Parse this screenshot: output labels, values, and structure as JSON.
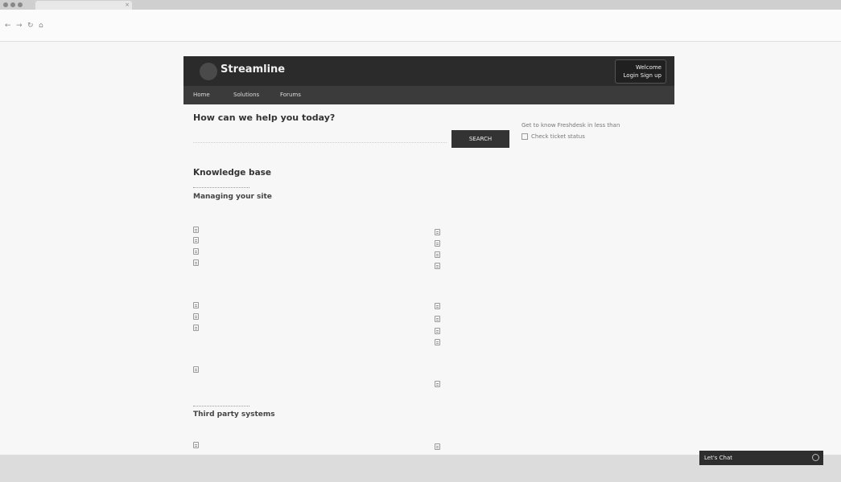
{
  "browser": {
    "tab_label": "",
    "tab2_label": "",
    "url": ""
  },
  "site": {
    "name": "Streamline",
    "account_lines": [
      "Welcome",
      "Login Sign up"
    ],
    "nav": [
      "Home",
      "Solutions",
      "Forums"
    ]
  },
  "search": {
    "title": "How can we help you today?",
    "placeholder": "",
    "button_label": "SEARCH",
    "side_links": [
      "Get to know Freshdesk in less than",
      "Check ticket status"
    ]
  },
  "kb": {
    "title": "Knowledge base",
    "section1": "Managing your site",
    "section2": "Third party systems",
    "columns": [
      {
        "categories": [
          {
            "title": "",
            "articles": [
              "",
              "",
              "",
              ""
            ]
          },
          {
            "title": "",
            "articles": [
              "",
              "",
              ""
            ]
          },
          {
            "title": "",
            "articles": [
              ""
            ]
          }
        ]
      },
      {
        "categories": [
          {
            "title": "",
            "articles": [
              "",
              "",
              "",
              ""
            ]
          },
          {
            "title": "",
            "articles": [
              "",
              "",
              "",
              ""
            ]
          },
          {
            "title": "",
            "articles": [
              ""
            ]
          }
        ]
      }
    ],
    "third_party": [
      {
        "title": "",
        "articles": [
          ""
        ]
      },
      {
        "title": "",
        "articles": [
          ""
        ]
      }
    ]
  },
  "chat": {
    "label": "Let's Chat"
  },
  "status_text": ""
}
